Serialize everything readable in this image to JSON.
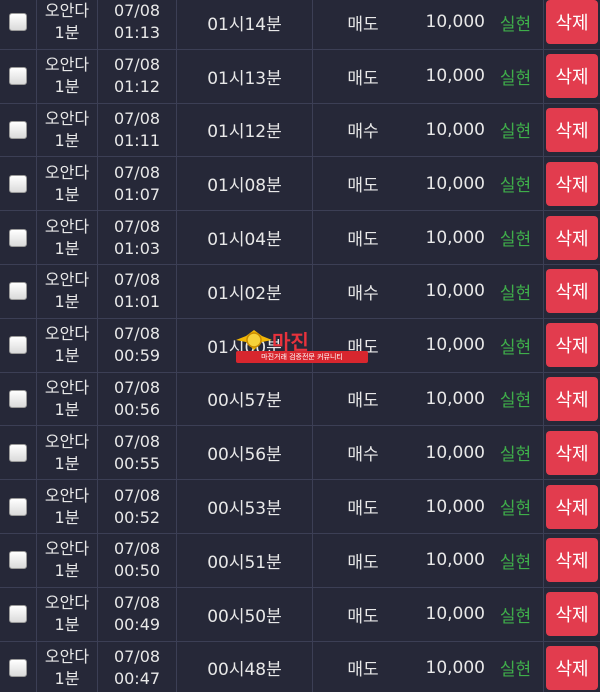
{
  "delete_label": "삭제",
  "status_color": "#3fae4a",
  "delete_color": "#e23c4e",
  "rows": [
    {
      "name_line1": "오안다",
      "name_line2": "1분",
      "date": "07/08",
      "time": "01:13",
      "minute": "01시14분",
      "type": "매도",
      "amount": "10,000",
      "status": "실현"
    },
    {
      "name_line1": "오안다",
      "name_line2": "1분",
      "date": "07/08",
      "time": "01:12",
      "minute": "01시13분",
      "type": "매도",
      "amount": "10,000",
      "status": "실현"
    },
    {
      "name_line1": "오안다",
      "name_line2": "1분",
      "date": "07/08",
      "time": "01:11",
      "minute": "01시12분",
      "type": "매수",
      "amount": "10,000",
      "status": "실현"
    },
    {
      "name_line1": "오안다",
      "name_line2": "1분",
      "date": "07/08",
      "time": "01:07",
      "minute": "01시08분",
      "type": "매도",
      "amount": "10,000",
      "status": "실현"
    },
    {
      "name_line1": "오안다",
      "name_line2": "1분",
      "date": "07/08",
      "time": "01:03",
      "minute": "01시04분",
      "type": "매도",
      "amount": "10,000",
      "status": "실현"
    },
    {
      "name_line1": "오안다",
      "name_line2": "1분",
      "date": "07/08",
      "time": "01:01",
      "minute": "01시02분",
      "type": "매수",
      "amount": "10,000",
      "status": "실현"
    },
    {
      "name_line1": "오안다",
      "name_line2": "1분",
      "date": "07/08",
      "time": "00:59",
      "minute": "01시00분",
      "type": "매도",
      "amount": "10,000",
      "status": "실현"
    },
    {
      "name_line1": "오안다",
      "name_line2": "1분",
      "date": "07/08",
      "time": "00:56",
      "minute": "00시57분",
      "type": "매도",
      "amount": "10,000",
      "status": "실현"
    },
    {
      "name_line1": "오안다",
      "name_line2": "1분",
      "date": "07/08",
      "time": "00:55",
      "minute": "00시56분",
      "type": "매수",
      "amount": "10,000",
      "status": "실현"
    },
    {
      "name_line1": "오안다",
      "name_line2": "1분",
      "date": "07/08",
      "time": "00:52",
      "minute": "00시53분",
      "type": "매도",
      "amount": "10,000",
      "status": "실현"
    },
    {
      "name_line1": "오안다",
      "name_line2": "1분",
      "date": "07/08",
      "time": "00:50",
      "minute": "00시51분",
      "type": "매도",
      "amount": "10,000",
      "status": "실현"
    },
    {
      "name_line1": "오안다",
      "name_line2": "1분",
      "date": "07/08",
      "time": "00:49",
      "minute": "00시50분",
      "type": "매도",
      "amount": "10,000",
      "status": "실현"
    },
    {
      "name_line1": "오안다",
      "name_line2": "1분",
      "date": "07/08",
      "time": "00:47",
      "minute": "00시48분",
      "type": "매도",
      "amount": "10,000",
      "status": "실현"
    }
  ],
  "watermark": {
    "title": "마진",
    "subtitle": "마진거래 검증전문 커뮤니티"
  }
}
